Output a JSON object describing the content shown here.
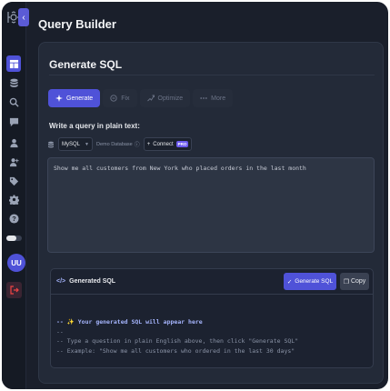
{
  "header": {
    "title": "Query Builder"
  },
  "sidebar": {
    "items": [
      {
        "icon": "dashboard-icon",
        "active": true
      },
      {
        "icon": "database-icon"
      },
      {
        "icon": "search-icon"
      },
      {
        "icon": "chat-icon"
      },
      {
        "icon": "user-icon"
      },
      {
        "icon": "user-add-icon"
      },
      {
        "icon": "tag-icon"
      },
      {
        "icon": "gear-icon"
      },
      {
        "icon": "help-icon"
      }
    ],
    "avatar_initials": "UU"
  },
  "card": {
    "title": "Generate SQL",
    "tabs": [
      {
        "label": "Generate",
        "icon": "sparkle-icon",
        "active": true
      },
      {
        "label": "Fix",
        "icon": "wrench-icon",
        "active": false
      },
      {
        "label": "Optimize",
        "icon": "optimize-icon",
        "active": false
      },
      {
        "label": "More",
        "icon": "dots-icon",
        "active": false
      }
    ],
    "query_label": "Write a query in plain text:",
    "db_select": {
      "value": "MySQL"
    },
    "db_name": "Demo Database",
    "connect": {
      "label": "Connect",
      "badge": "PRO"
    },
    "query_value": "Show me all customers from New York who placed orders in the last month"
  },
  "sql_panel": {
    "title": "Generated SQL",
    "generate_label": "Generate SQL",
    "copy_label": "Copy",
    "lines": [
      "-- ✨ Your generated SQL will appear here",
      "--",
      "-- Type a question in plain English above, then click \"Generate SQL\"",
      "-- Example: \"Show me all customers who ordered in the last 30 days\""
    ]
  },
  "colors": {
    "accent": "#4f52d8",
    "danger": "#ef4444",
    "background": "#1a1f2b"
  }
}
